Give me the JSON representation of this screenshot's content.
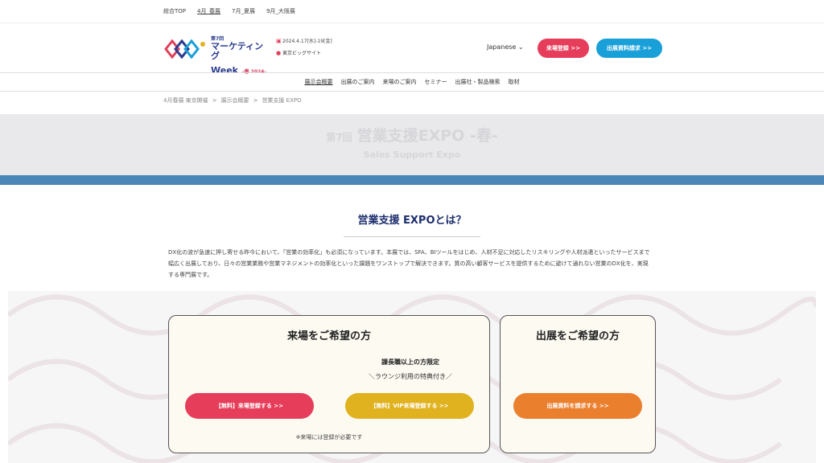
{
  "topnav": {
    "items": [
      "総合TOP",
      "4月_春展",
      "7月_夏展",
      "9月_大阪展"
    ]
  },
  "logo": {
    "edition": "第7回",
    "name": "マーケティング",
    "week": "Week",
    "season": "-春 2024-"
  },
  "event": {
    "date": "2024.4.17[水]-19[金]",
    "venue": "東京ビッグサイト"
  },
  "header": {
    "language": "Japanese",
    "visit_button": "来場登録 >>",
    "exhibit_button": "出展資料請求 >>"
  },
  "mainnav": {
    "items": [
      "展示会概要",
      "出展のご案内",
      "来場のご案内",
      "セミナー",
      "出展社・製品検索",
      "取材"
    ]
  },
  "breadcrumb": {
    "items": [
      "4月春展 東京開催",
      "展示会概要",
      "営業支援 EXPO"
    ],
    "separator": ">"
  },
  "hero": {
    "edition": "第7回",
    "title": "営業支援EXPO -春-",
    "subtitle": "Sales Support Expo"
  },
  "about": {
    "title": "営業支援 EXPOとは？",
    "description": "DX化の波が急速に押し寄せる昨今において、「営業の効率化」も必須になっています。本展では、SFA、BIツールをはじめ、人材不足に対応したリスキリングや人材派遣といったサービスまで幅広く出展しており、日々の営業業務や営業マネジメントの効率化といった課題をワンストップで解決できます。質の高い顧客サービスを提供するために避けて通れない営業のDX化を、実現する専門展です。"
  },
  "visit_card": {
    "title": "来場をご希望の方",
    "vip_note": "課長職以上の方限定",
    "vip_sub": "＼ラウンジ利用の特典付き／",
    "free_button": "【無料】来場登録する >>",
    "vip_button": "【無料】VIP来場登録する >>",
    "note": "※来場には登録が必要です"
  },
  "exhibit_card": {
    "title": "出展をご希望の方",
    "doc_button": "出展資料を請求する >>"
  },
  "colors": {
    "brand_navy": "#1e2f6e",
    "accent_red": "#e53d5a",
    "accent_blue": "#1aa0d8",
    "accent_gold": "#e0b21f",
    "accent_orange": "#ea7f2e",
    "hero_band": "#4a86b8"
  }
}
